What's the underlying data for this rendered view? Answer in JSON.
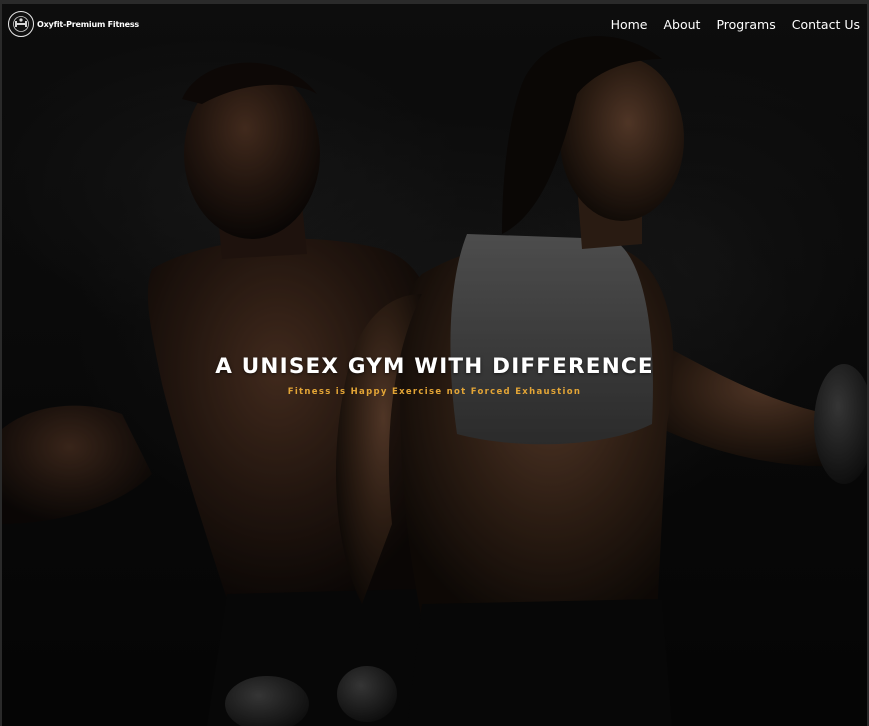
{
  "brand": {
    "name": "Oxyfit-Premium Fitness",
    "logo_icon": "gym-badge-icon"
  },
  "nav": {
    "items": [
      {
        "label": "Home"
      },
      {
        "label": "About"
      },
      {
        "label": "Programs"
      },
      {
        "label": "Contact Us"
      }
    ]
  },
  "hero": {
    "title": "A UNISEX GYM WITH DIFFERENCE",
    "subtitle": "Fitness is Happy Exercise not Forced Exhaustion",
    "accent_color": "#e3a536"
  }
}
